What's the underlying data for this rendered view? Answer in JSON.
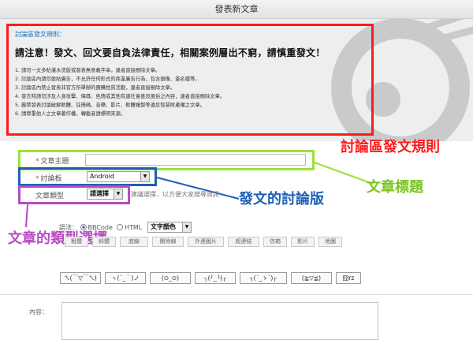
{
  "window": {
    "title": "發表新文章"
  },
  "rules": {
    "title": "討論區發文規則：",
    "warning": "請注意！發文、回文要自負法律責任，相關案例層出不窮，請慎重發文！",
    "items": [
      "1.  請勿一文多貼灌水洗版或發表無意義字串，違者直接刪除文章。",
      "2.  討論區內請勿張貼廣告，不允許任何形式的商業廣告行為，包含頭像、簽名檔等。",
      "3.  討論區內禁止發表非官方所舉辦的團購性質活動，違者直接刪除文章。",
      "4.  發言時請勿涉及人身攻擊、侮辱、色情或其他有違社會善良風俗之內容，違者直接刪除文章。",
      "5.  嚴禁發表討論破解軟體、註冊碼、音樂、影片、軟體複製等違反智慧財產權之文章。",
      "6.  請尊重他人之文章著作權，轉載者請標明來源。"
    ]
  },
  "annotations": {
    "rules_label": "討論區發文規則",
    "subject_label": "文章標題",
    "board_label": "發文的討論版",
    "type_label": "文章的類型選擇"
  },
  "form": {
    "subject_label": "文章主題",
    "board_label": "討論板",
    "board_value": "Android",
    "type_label": "文章類型",
    "type_value": "請選擇",
    "type_hint": "建議選擇，以方便大家搜尋資訊",
    "syntax_label": "語法：",
    "syntax_bbcode": "BBCode",
    "syntax_html": "HTML",
    "font_color": "文字顏色",
    "edit_buttons": [
      "粗體",
      "斜體",
      "底線",
      "刪除線",
      "外連圖片",
      "超連結",
      "信箱",
      "影片",
      "地圖"
    ],
    "emoticons": [
      "ㄟ(￣▽￣ㄟ)",
      "ヽ(´_｀)ノ",
      "(⊙_⊙)",
      "╮(╯_╰)╭",
      "┐(´_ゝ`)┌",
      "(≧▽≦)",
      "囧rz"
    ],
    "content_label": "內容："
  },
  "colors": {
    "rules_border": "#ff1a1a",
    "subject_box": "#9be13c",
    "board_box": "#1f5fb5",
    "type_box": "#b84bc4",
    "rules_label": "#ff1a1a",
    "subject_label": "#7cc323",
    "board_label": "#1f5fb5",
    "type_label": "#b84bc4"
  }
}
